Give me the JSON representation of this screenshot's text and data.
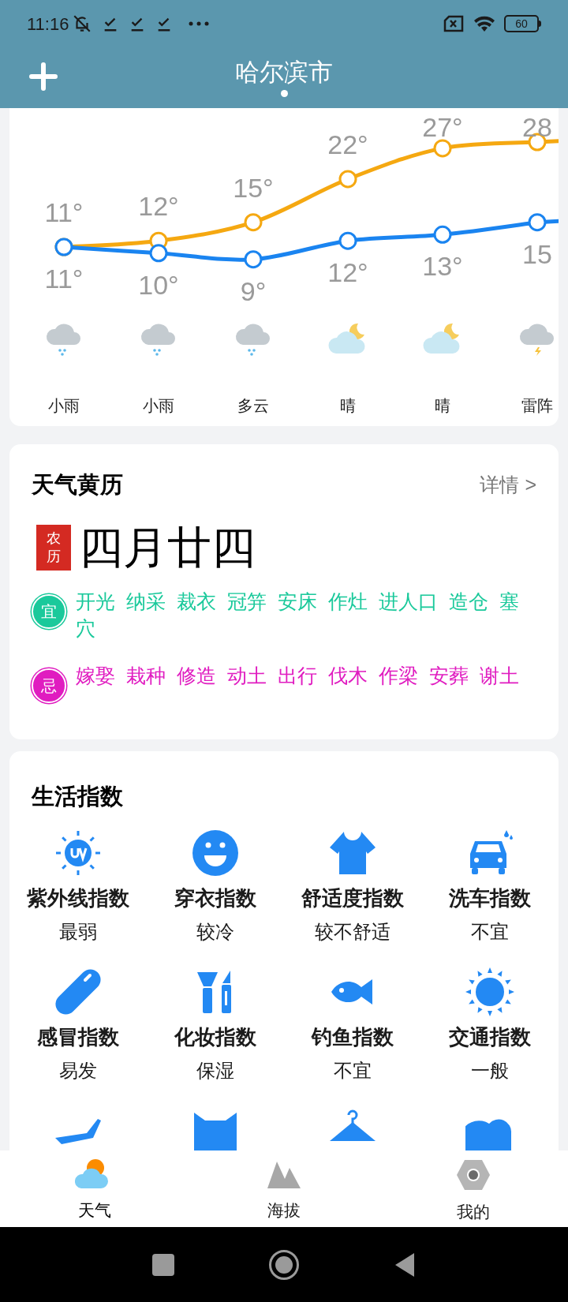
{
  "status_bar": {
    "time": "11:16",
    "battery": "60"
  },
  "header": {
    "title": "哈尔滨市"
  },
  "forecast": {
    "days": [
      {
        "high": "11°",
        "low": "11°",
        "weather": "小雨",
        "kind": "rain"
      },
      {
        "high": "12°",
        "low": "10°",
        "weather": "小雨",
        "kind": "rain"
      },
      {
        "high": "15°",
        "low": "9°",
        "weather": "多云",
        "kind": "rain"
      },
      {
        "high": "22°",
        "low": "12°",
        "weather": "晴",
        "kind": "night-clear"
      },
      {
        "high": "27°",
        "low": "13°",
        "weather": "晴",
        "kind": "night-clear"
      },
      {
        "high": "28",
        "low": "15",
        "weather": "雷阵",
        "kind": "thunder"
      }
    ]
  },
  "almanac": {
    "title": "天气黄历",
    "detail_link": "详情 >",
    "seal": "农历",
    "lunar_date": "四月廿四",
    "rows": [
      {
        "kind": "good",
        "badge": "宜",
        "items": [
          "开光",
          "纳采",
          "裁衣",
          "冠笄",
          "安床",
          "作灶",
          "进人口",
          "造仓",
          "塞穴"
        ]
      },
      {
        "kind": "bad",
        "badge": "忌",
        "items": [
          "嫁娶",
          "栽种",
          "修造",
          "动土",
          "出行",
          "伐木",
          "作梁",
          "安葬",
          "谢土"
        ]
      }
    ]
  },
  "life_index": {
    "title": "生活指数",
    "items": [
      {
        "kind": "uv",
        "label": "紫外线指数",
        "value": "最弱"
      },
      {
        "kind": "smile",
        "label": "穿衣指数",
        "value": "较冷"
      },
      {
        "kind": "shirt",
        "label": "舒适度指数",
        "value": "较不舒适"
      },
      {
        "kind": "car",
        "label": "洗车指数",
        "value": "不宜"
      },
      {
        "kind": "pill",
        "label": "感冒指数",
        "value": "易发"
      },
      {
        "kind": "makeup",
        "label": "化妆指数",
        "value": "保湿"
      },
      {
        "kind": "fish",
        "label": "钓鱼指数",
        "value": "不宜"
      },
      {
        "kind": "sun",
        "label": "交通指数",
        "value": "一般"
      },
      {
        "kind": "plane"
      },
      {
        "kind": "cat"
      },
      {
        "kind": "hanger"
      },
      {
        "kind": "cloud"
      }
    ]
  },
  "bottom_nav": [
    {
      "label": "天气",
      "kind": "weather",
      "selected": true
    },
    {
      "label": "海拔",
      "kind": "mountain",
      "selected": false
    },
    {
      "label": "我的",
      "kind": "hexagon",
      "selected": false
    }
  ]
}
